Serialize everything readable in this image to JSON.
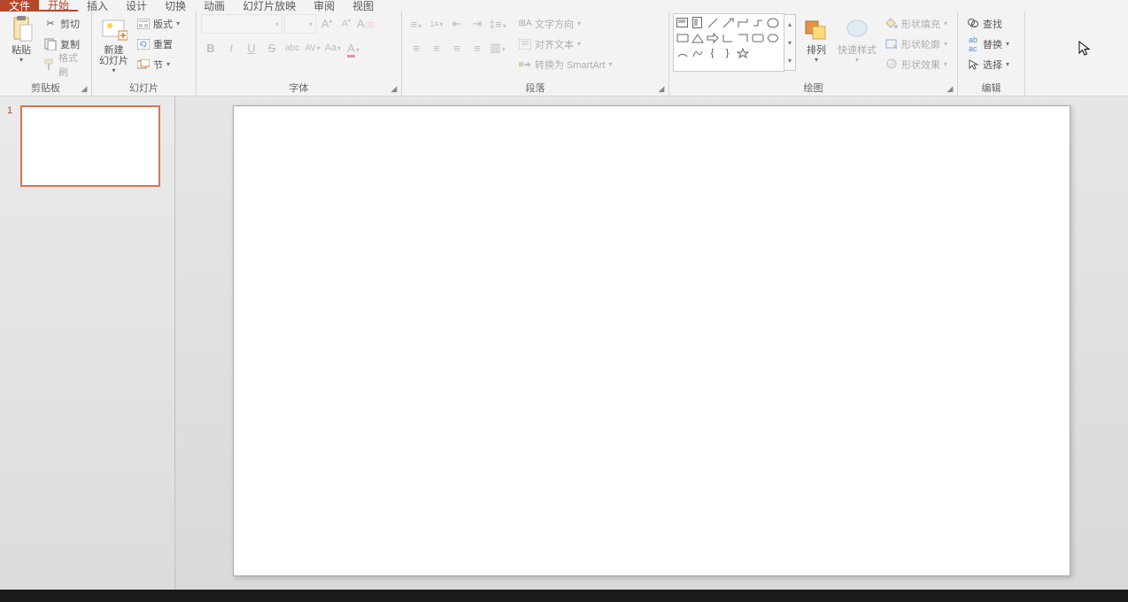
{
  "tabs": {
    "file": "文件",
    "home": "开始",
    "insert": "插入",
    "design": "设计",
    "transitions": "切换",
    "animations": "动画",
    "slideshow": "幻灯片放映",
    "review": "审阅",
    "view": "视图"
  },
  "clipboard": {
    "paste": "粘贴",
    "cut": "剪切",
    "copy": "复制",
    "format_painter": "格式刷",
    "group": "剪贴板"
  },
  "slides": {
    "new_slide": "新建\n幻灯片",
    "layout": "版式",
    "reset": "重置",
    "section": "节",
    "group": "幻灯片"
  },
  "font": {
    "font_name": "",
    "font_size": "",
    "group": "字体"
  },
  "paragraph": {
    "text_direction": "文字方向",
    "align_text": "对齐文本",
    "convert_smartart": "转换为 SmartArt",
    "group": "段落"
  },
  "drawing": {
    "arrange": "排列",
    "quick_styles": "快速样式",
    "shape_fill": "形状填充",
    "shape_outline": "形状轮廓",
    "shape_effects": "形状效果",
    "group": "绘图"
  },
  "editing": {
    "find": "查找",
    "replace": "替换",
    "select": "选择",
    "group": "编辑"
  },
  "slide_panel": {
    "slide_number": "1"
  },
  "status": {
    "text": ""
  },
  "colors": {
    "accent": "#b7472a"
  }
}
